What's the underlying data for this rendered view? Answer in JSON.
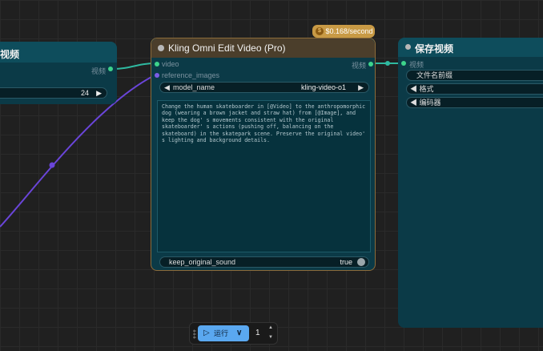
{
  "left_node": {
    "title": "视频",
    "output_label": "视频",
    "widget_value": "24",
    "widget_arrow": "▶"
  },
  "kling_node": {
    "title": "Kling Omni Edit Video (Pro)",
    "cost_badge": "$0.168/second",
    "inputs": {
      "video": "video",
      "reference_images": "reference_images"
    },
    "output_label": "视频",
    "model_name": {
      "label": "model_name",
      "value": "kling-video-o1",
      "arrow_left": "◀",
      "arrow_right": "▶"
    },
    "prompt": "Change the human skateboarder in [@Video] to the anthropomorphic dog (wearing a brown jacket and straw hat) from [@Image], and keep the dog' s movements consistent with the original skateboarder' s actions (pushing off, balancing on the skateboard) in the skatepark scene. Preserve the original video' s lighting and background details.",
    "keep_sound": {
      "label": "keep_original_sound",
      "value": "true"
    }
  },
  "save_node": {
    "title": "保存视频",
    "input_label": "视频",
    "filename_label": "文件名前缀",
    "format_label": "◀ 格式",
    "codec_label": "◀ 编码器"
  },
  "run_toolbar": {
    "run_label": "运行",
    "play_icon": "▷",
    "dropdown_icon": "∨",
    "count": "1",
    "up_icon": "▲",
    "down_icon": "▼"
  },
  "colors": {
    "canvas": "#202020",
    "node_body": "#0b3a47",
    "node_header": "#0e4d5c",
    "kling_header": "#4b3e2b",
    "kling_border": "#8b6b3a",
    "badge": "#c89a45",
    "wire_video": "#2fb9a0",
    "wire_image": "#6a45d9",
    "run_button": "#5aa8f0"
  }
}
